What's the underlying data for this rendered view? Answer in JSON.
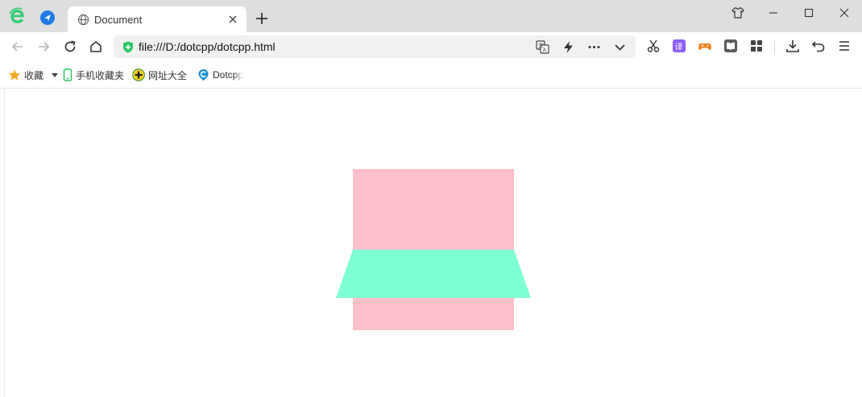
{
  "browser": {
    "tab": {
      "title": "Document"
    },
    "address_bar": {
      "url": "file:///D:/dotcpp/dotcpp.html"
    },
    "bookmarks": [
      {
        "label": "收藏",
        "icon": "star-icon"
      },
      {
        "label": "手机收藏夹",
        "icon": "phone-icon"
      },
      {
        "label": "网址大全",
        "icon": "web-directory-icon"
      },
      {
        "label": "Dotcpp",
        "icon": "dotcpp-icon"
      }
    ],
    "toolbar_icons": [
      "translate-icon",
      "lightning-icon",
      "more-icon",
      "dropdown-icon",
      "scissors-icon",
      "translate-purple-icon",
      "game-icon",
      "reader-icon",
      "apps-icon",
      "download-icon",
      "undo-icon",
      "menu-icon"
    ]
  },
  "page": {
    "shapes": [
      {
        "name": "pink-square",
        "color": "#ffc0cb"
      },
      {
        "name": "aquamarine-trapezoid",
        "color": "#7fffd4"
      }
    ]
  }
}
